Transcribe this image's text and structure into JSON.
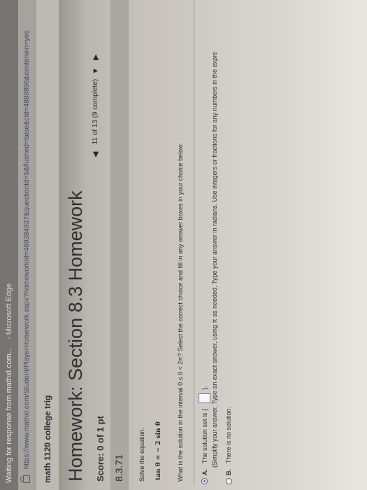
{
  "browser": {
    "window_title": "Waiting for response from mathxl.com...",
    "app_name": "- Microsoft Edge",
    "url": "https://www.mathxl.com/Student/PlayerHomework.aspx?homeworkId=469384937&questionId=5&flushed=false&cId=4889896&centerwin=yes"
  },
  "course": {
    "name": "math 1120 college trig"
  },
  "homework": {
    "title": "Homework: Section 8.3 Homework",
    "score_label": "Score: 0 of 1 pt",
    "progress": "11 of 13 (9 complete)",
    "prev_icon": "left-triangle-icon",
    "progress_icon": "down-triangle-icon",
    "next_icon": "right-triangle-icon"
  },
  "question": {
    "number": "8.3.71",
    "instruction": "Solve the equation.",
    "equation": "tan θ = − 2 sin θ",
    "prompt": "What is the solution in the interval 0 ≤ θ < 2π? Select the correct choice and fill in any answer boxes in your choice below.",
    "choice_a": {
      "letter": "A.",
      "label": "The solution set is {",
      "close": "}.",
      "hint": "(Simplify your answer. Type an exact answer, using π as needed. Type your answer in radians. Use integers or fractions for any numbers in the expre",
      "selected": true,
      "answer_value": ""
    },
    "choice_b": {
      "letter": "B.",
      "label": "There is no solution.",
      "selected": false
    }
  }
}
